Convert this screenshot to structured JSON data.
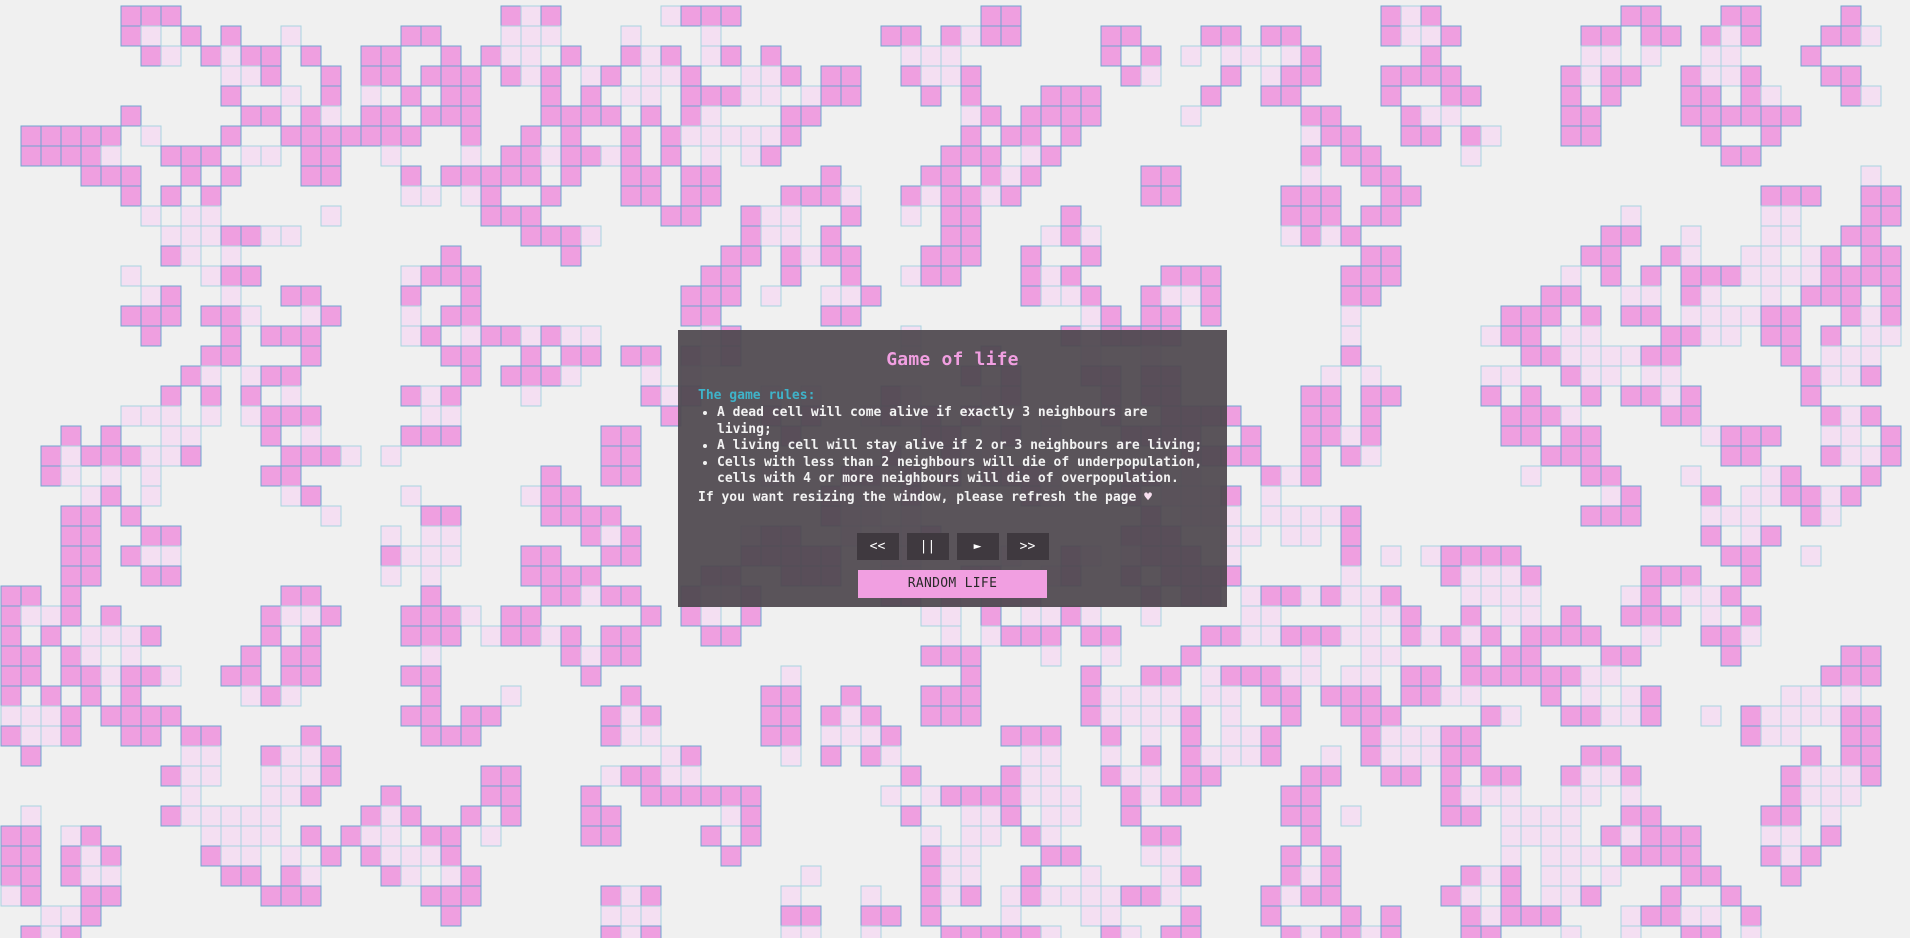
{
  "game": {
    "grid_cols": 95,
    "grid_rows": 47,
    "colors": {
      "background": "#f0f0f0",
      "alive_fill": "#ef9fe0",
      "alive_stroke": "#6fa6d0",
      "ghost_fill": "#f4dff2",
      "ghost_stroke": "#a8d3e0"
    }
  },
  "panel": {
    "title": "Game of life",
    "rules_heading": "The game rules:",
    "rules": [
      "A dead cell will come alive if exactly 3 neighbours are living;",
      "A living cell will stay alive if 2 or 3 neighbours are living;",
      "Cells with less than 2 neighbours will die of underpopulation, cells with 4 or more neighbours will die of overpopulation."
    ],
    "resize_note": "If you want resizing the window, please refresh the page",
    "heart_icon": "♥"
  },
  "controls": {
    "prev_label": "<<",
    "pause_label": "||",
    "play_label": "►",
    "next_label": ">>",
    "random_label": "RANDOM LIFE"
  }
}
